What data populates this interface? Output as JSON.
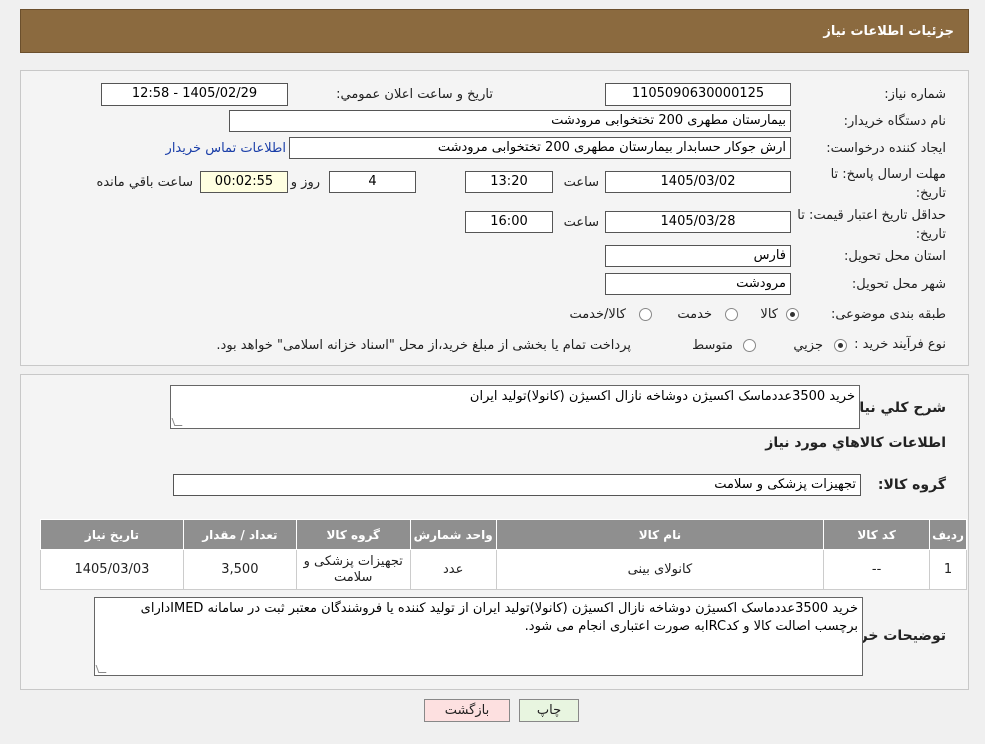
{
  "header": {
    "title": "جزئیات اطلاعات نیاز"
  },
  "form": {
    "need_number_label": "شماره نیاز:",
    "need_number": "1105090630000125",
    "announce_label": "تاریخ و ساعت اعلان عمومي:",
    "announce_value": "1405/02/29 - 12:58",
    "buyer_org_label": "نام دستگاه خريدار:",
    "buyer_org": "بیمارستان مطهری  200 تختخوابی مرودشت",
    "requester_label": "ايجاد کننده درخواست:",
    "requester": "ارش  جوکار حسابدار بیمارستان مطهری  200 تختخوابی مرودشت",
    "contact_link": "اطلاعات تماس خریدار",
    "reply_deadline_label": "مهلت ارسال پاسخ: تا تاریخ:",
    "reply_date": "1405/03/02",
    "time_label": "ساعت",
    "reply_time": "13:20",
    "days_value": "4",
    "days_label": "روز و",
    "remaining_value": "00:02:55",
    "remaining_label": "ساعت باقي مانده",
    "price_validity_label": "حداقل تاريخ اعتبار قيمت: تا تاريخ:",
    "price_date": "1405/03/28",
    "price_time": "16:00",
    "province_label": "استان محل تحویل:",
    "province": "فارس",
    "city_label": "شهر محل تحویل:",
    "city": "مرودشت",
    "category_label": "طبقه بندی موضوعی:",
    "category_options": [
      "کالا",
      "خدمت",
      "کالا/خدمت"
    ],
    "process_label": "نوع فرآيند خريد :",
    "process_options": [
      "جزيي",
      "متوسط"
    ],
    "process_note": "پرداخت تمام یا بخشی از مبلغ خرید،از محل \"اسناد خزانه اسلامی\" خواهد بود."
  },
  "details": {
    "summary_label": "شرح كلي نياز:",
    "summary": "خرید 3500عددماسک اکسیژن دوشاخه نازال اکسیژن (کانولا)تولید ایران",
    "goods_title": "اطلاعات كالاهاي مورد نياز",
    "group_label": "گروه کالا:",
    "group_value": "تجهیزات پزشکی و سلامت",
    "table": {
      "headers": [
        "رديف",
        "کد کالا",
        "نام کالا",
        "واحد شمارش",
        "گروه کالا",
        "تعداد / مقدار",
        "تاريخ نياز"
      ],
      "rows": [
        [
          "1",
          "--",
          "کانولای بینی",
          "عدد",
          "تجهیزات پزشکی و سلامت",
          "3,500",
          "1405/03/03"
        ]
      ]
    },
    "buyer_notes_label": "توضيحات خريدار:",
    "buyer_notes": "خرید 3500عددماسک اکسیژن دوشاخه نازال اکسیژن (کانولا)تولید ایران از تولید کننده یا فروشندگان معتبر ثبت در سامانه IMEDدارای برچسب اصالت کالا و کدIRCبه صورت اعتباری انجام می شود."
  },
  "buttons": {
    "print": "چاپ",
    "back": "بازگشت"
  },
  "colors": {
    "header_bg": "#8b6a3f",
    "table_header_bg": "#8f8f8f",
    "back_btn_bg": "#fde0e0",
    "print_btn_bg": "#e8f5e0"
  }
}
